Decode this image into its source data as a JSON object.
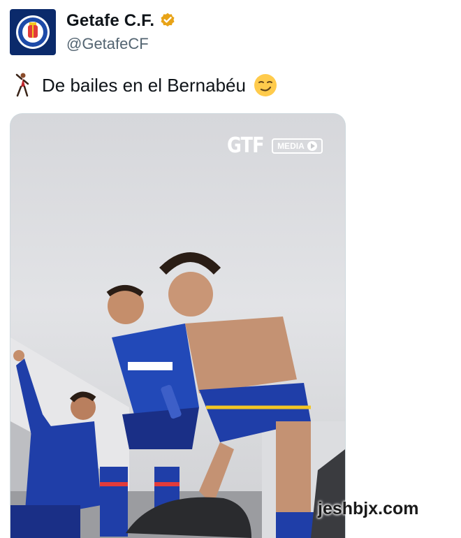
{
  "account": {
    "display_name": "Getafe C.F.",
    "handle": "@GetafeCF",
    "avatar_icon": "getafe-crest-icon",
    "verified_icon": "verified-badge-icon",
    "verified_color": "#e8a317"
  },
  "tweet": {
    "text": "De bailes en el Bernabéu",
    "leading_emoji": "dancer-icon",
    "trailing_emoji": "smirk-face-icon"
  },
  "media": {
    "logo_text": "GTF",
    "badge_text": "MEDIA"
  },
  "watermark": {
    "text": "jeshbjx.com"
  },
  "colors": {
    "kit_blue": "#1f3ea8",
    "text_primary": "#0f1419",
    "text_secondary": "#536471"
  }
}
